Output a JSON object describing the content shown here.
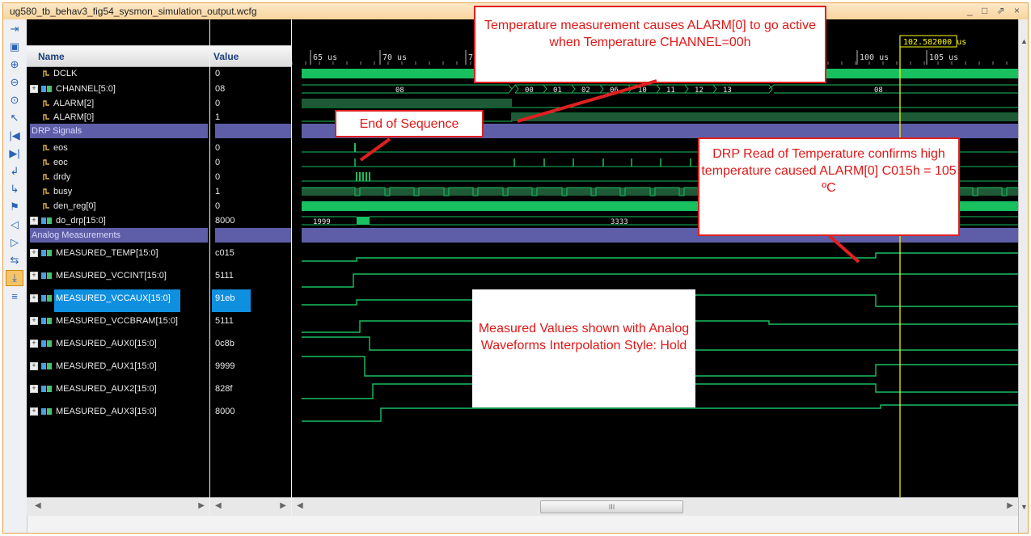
{
  "window": {
    "title": "ug580_tb_behav3_fig54_sysmon_simulation_output.wcfg",
    "controls": "_ □ ⇗ ×"
  },
  "toolbar": {
    "icons": [
      "zoom-fit-icon",
      "save-icon",
      "zoom-in-icon",
      "zoom-out-icon",
      "zoom-full-icon",
      "cursor-icon",
      "go-first-icon",
      "go-last-icon",
      "prev-transition-icon",
      "next-transition-icon",
      "add-marker-icon",
      "prev-marker-icon",
      "next-marker-icon",
      "swap-cursors-icon",
      "snap-transition-icon",
      "divider-icon"
    ]
  },
  "names_header": "Name",
  "values_header": "Value",
  "signals": [
    {
      "name": "DCLK",
      "value": "0",
      "kind": "bit"
    },
    {
      "name": "CHANNEL[5:0]",
      "value": "08",
      "kind": "bus"
    },
    {
      "name": "ALARM[2]",
      "value": "0",
      "kind": "bit"
    },
    {
      "name": "ALARM[0]",
      "value": "1",
      "kind": "bit"
    },
    {
      "name": "DRP Signals",
      "value": "",
      "kind": "group"
    },
    {
      "name": "eos",
      "value": "0",
      "kind": "bit"
    },
    {
      "name": "eoc",
      "value": "0",
      "kind": "bit"
    },
    {
      "name": "drdy",
      "value": "0",
      "kind": "bit"
    },
    {
      "name": "busy",
      "value": "1",
      "kind": "bit"
    },
    {
      "name": "den_reg[0]",
      "value": "0",
      "kind": "bit"
    },
    {
      "name": "do_drp[15:0]",
      "value": "8000",
      "kind": "bus"
    },
    {
      "name": "Analog Measurements",
      "value": "",
      "kind": "group"
    },
    {
      "name": "MEASURED_TEMP[15:0]",
      "value": "c015",
      "kind": "bus"
    },
    {
      "name": "MEASURED_VCCINT[15:0]",
      "value": "5111",
      "kind": "bus"
    },
    {
      "name": "MEASURED_VCCAUX[15:0]",
      "value": "91eb",
      "kind": "bus",
      "selected": true
    },
    {
      "name": "MEASURED_VCCBRAM[15:0]",
      "value": "5111",
      "kind": "bus"
    },
    {
      "name": "MEASURED_AUX0[15:0]",
      "value": "0c8b",
      "kind": "bus"
    },
    {
      "name": "MEASURED_AUX1[15:0]",
      "value": "9999",
      "kind": "bus"
    },
    {
      "name": "MEASURED_AUX2[15:0]",
      "value": "828f",
      "kind": "bus"
    },
    {
      "name": "MEASURED_AUX3[15:0]",
      "value": "8000",
      "kind": "bus"
    }
  ],
  "timeline": {
    "labels": [
      "65 us",
      "70 us",
      "7",
      "100 us",
      "105 us"
    ],
    "cursor_label": "102.582000 us"
  },
  "bus_values": {
    "channel": [
      "08",
      "00",
      "01",
      "02",
      "06",
      "10",
      "11",
      "12",
      "13",
      "08"
    ],
    "do_drp": [
      "1999",
      "3333",
      "8000"
    ]
  },
  "callouts": {
    "temp": "Temperature measurement causes ALARM[0] to go active when Temperature CHANNEL=00h",
    "eos": "End of Sequence",
    "drp": "DRP Read of Temperature confirms high temperature caused ALARM[0] C015h = 105 ºC",
    "analog": "Measured Values shown with Analog Waveforms Interpolation Style: Hold"
  },
  "scrollbar": {
    "thumb_grip": "III"
  },
  "colors": {
    "wave_green": "#18c060",
    "group_band": "#5e5ea8",
    "cursor": "#ffff00",
    "callout_red": "#e02020",
    "selection": "#0f8fe0"
  }
}
